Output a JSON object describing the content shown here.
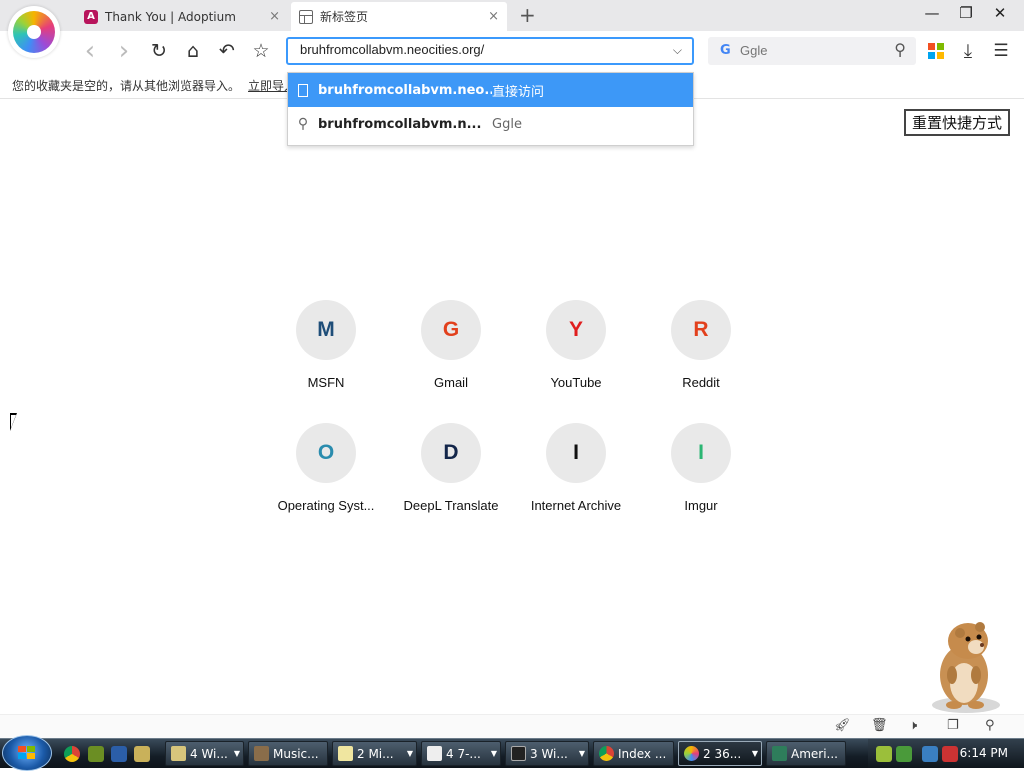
{
  "tabs": [
    {
      "title": "Thank You | Adoptium",
      "close": "×"
    },
    {
      "title": "新标签页",
      "close": "×"
    }
  ],
  "new_tab": "+",
  "window_controls": {
    "minimize": "—",
    "restore": "❐",
    "close": "✕"
  },
  "nav": {
    "back": "‹",
    "forward": "›",
    "reload": "↻",
    "home": "⌂",
    "undo": "↶",
    "star": "☆"
  },
  "address": {
    "value": "bruhfromcollabvm.neocities.org/",
    "dropdown": "⌵"
  },
  "search": {
    "engine_glyph": "G",
    "placeholder": "Ggle",
    "icon": "⚲"
  },
  "toolbar_right": {
    "download": "⤓",
    "menu": "☰"
  },
  "bookmarks_bar": {
    "text": "您的收藏夹是空的，请从其他浏览器导入。",
    "link": "立即导入"
  },
  "suggestions": [
    {
      "url": "bruhfromcollabvm.neo...",
      "action": "直接访问",
      "selected": true
    },
    {
      "url": "bruhfromcollabvm.n...",
      "action": "Ggle",
      "selected": false
    }
  ],
  "reset_button": "重置快捷方式",
  "shortcuts": [
    {
      "letter": "M",
      "label": "MSFN",
      "color": "#1f4e79"
    },
    {
      "letter": "G",
      "label": "Gmail",
      "color": "#e2401c"
    },
    {
      "letter": "Y",
      "label": "YouTube",
      "color": "#e01e1e"
    },
    {
      "letter": "R",
      "label": "Reddit",
      "color": "#e2401c"
    },
    {
      "letter": "O",
      "label": "Operating Syst...",
      "color": "#2a8cae"
    },
    {
      "letter": "D",
      "label": "DeepL Translate",
      "color": "#13264a"
    },
    {
      "letter": "I",
      "label": "Internet Archive",
      "color": "#111111"
    },
    {
      "letter": "I",
      "label": "Imgur",
      "color": "#2bb673"
    }
  ],
  "taskbar": {
    "tasks": [
      {
        "label": "4 Wi...",
        "icon": "folder-icon",
        "active": false
      },
      {
        "label": "Music...",
        "icon": "music-icon",
        "active": false
      },
      {
        "label": "2 Mi...",
        "icon": "notepad-icon",
        "active": false
      },
      {
        "label": "4 7-...",
        "icon": "7zip-icon",
        "active": false
      },
      {
        "label": "3 Wi...",
        "icon": "console-icon",
        "active": false
      },
      {
        "label": "Index ...",
        "icon": "chrome-icon",
        "active": false
      },
      {
        "label": "2 36...",
        "icon": "browser-icon",
        "active": true
      },
      {
        "label": "Ameri...",
        "icon": "game-icon",
        "active": false
      }
    ],
    "clock": "6:14 PM"
  }
}
